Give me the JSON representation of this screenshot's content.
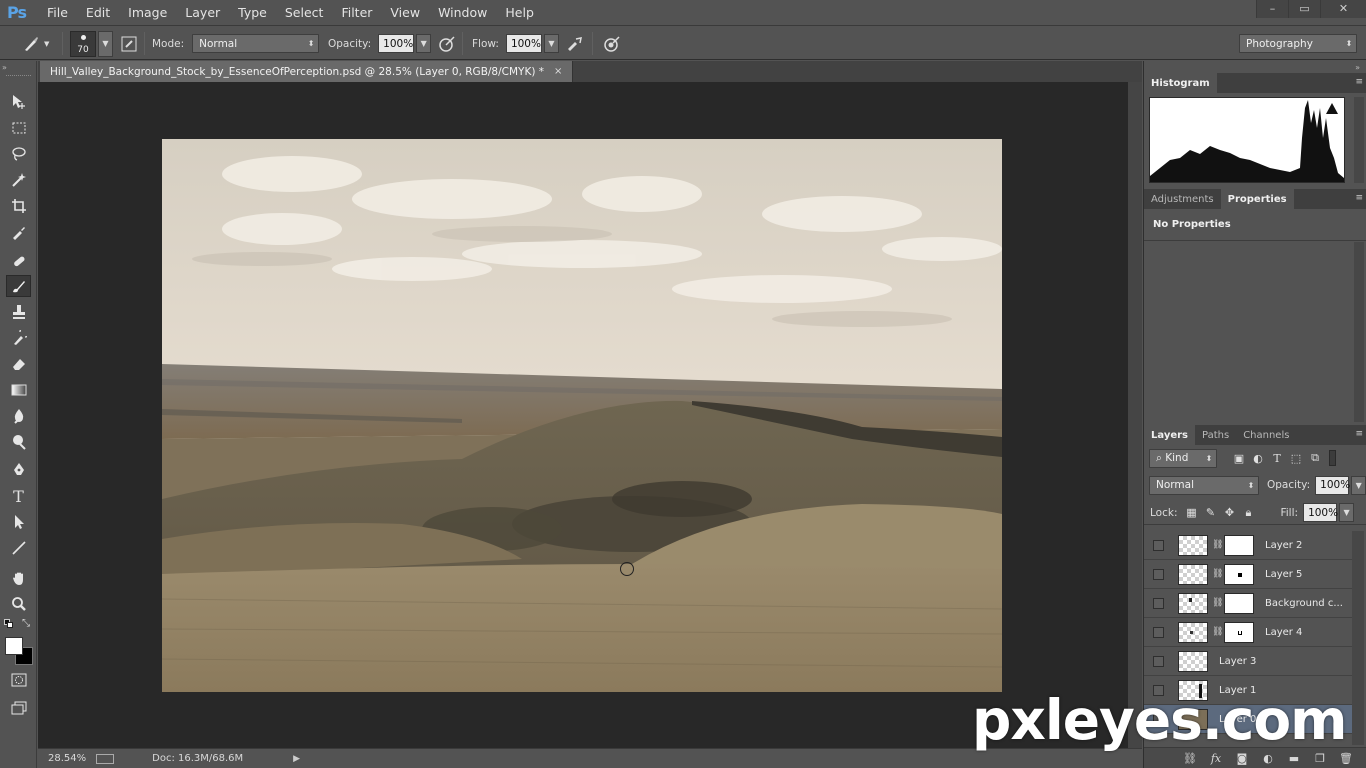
{
  "app": {
    "logo_text": "Ps",
    "menus": [
      "File",
      "Edit",
      "Image",
      "Layer",
      "Type",
      "Select",
      "Filter",
      "View",
      "Window",
      "Help"
    ],
    "window_controls": [
      "–",
      "▭",
      "✕"
    ]
  },
  "options_bar": {
    "brush_size": "70",
    "mode_label": "Mode:",
    "mode_value": "Normal",
    "opacity_label": "Opacity:",
    "opacity_value": "100%",
    "flow_label": "Flow:",
    "flow_value": "100%",
    "workspace_value": "Photography"
  },
  "document": {
    "tab_title": "Hill_Valley_Background_Stock_by_EssenceOfPerception.psd @ 28.5% (Layer 0, RGB/8/CMYK) *",
    "tab_close": "×"
  },
  "status_bar": {
    "zoom": "28.54%",
    "doc_info": "Doc: 16.3M/68.6M"
  },
  "panels": {
    "histogram_tab": "Histogram",
    "adjustments_tab": "Adjustments",
    "properties_tab": "Properties",
    "no_properties": "No Properties",
    "layers_tabs": [
      "Layers",
      "Paths",
      "Channels"
    ],
    "kind_filter": "Kind",
    "blend_mode": "Normal",
    "opacity_label": "Opacity:",
    "opacity_value": "100%",
    "lock_label": "Lock:",
    "fill_label": "Fill:",
    "fill_value": "100%"
  },
  "layers": [
    {
      "name": "Layer 2",
      "has_mask": true
    },
    {
      "name": "Layer 5",
      "has_mask": true
    },
    {
      "name": "Background c...",
      "has_mask": true
    },
    {
      "name": "Layer 4",
      "has_mask": true
    },
    {
      "name": "Layer 3",
      "has_mask": false
    },
    {
      "name": "Layer 1",
      "has_mask": false
    },
    {
      "name": "Layer 0",
      "has_mask": false
    }
  ],
  "watermark": "pxleyes.com",
  "colors": {
    "panel_bg": "#535353",
    "canvas_bg": "#282828",
    "accent": "#5aa3e6"
  }
}
